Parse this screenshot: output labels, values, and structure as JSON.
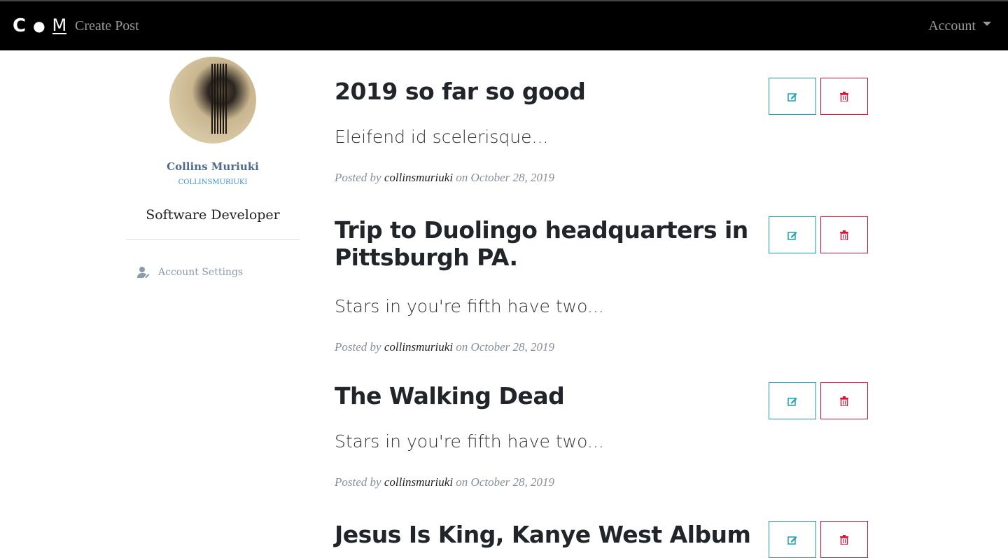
{
  "nav": {
    "logo": "C . M",
    "create_post": "Create Post",
    "account": "Account"
  },
  "profile": {
    "name": "Collins Muriuki",
    "username": "COLLINSMURIUKI",
    "bio": "Software Developer",
    "settings": "Account Settings"
  },
  "posts": [
    {
      "title": "2019 so far so good",
      "excerpt": "Eleifend id scelerisque...",
      "prefix": "Posted by",
      "author": "collinsmuriuki",
      "on": "on",
      "date": "October 28, 2019"
    },
    {
      "title": "Trip to Duolingo headquarters in Pittsburgh PA.",
      "excerpt": "Stars in you're fifth have two...",
      "prefix": "Posted by",
      "author": "collinsmuriuki",
      "on": "on",
      "date": "October 28, 2019"
    },
    {
      "title": "The Walking Dead",
      "excerpt": "Stars in you're fifth have two...",
      "prefix": "Posted by",
      "author": "collinsmuriuki",
      "on": "on",
      "date": "October 28, 2019"
    },
    {
      "title": "Jesus Is King, Kanye West Album"
    }
  ],
  "colors": {
    "edit": "#17a2b8",
    "delete": "#dc143c"
  }
}
